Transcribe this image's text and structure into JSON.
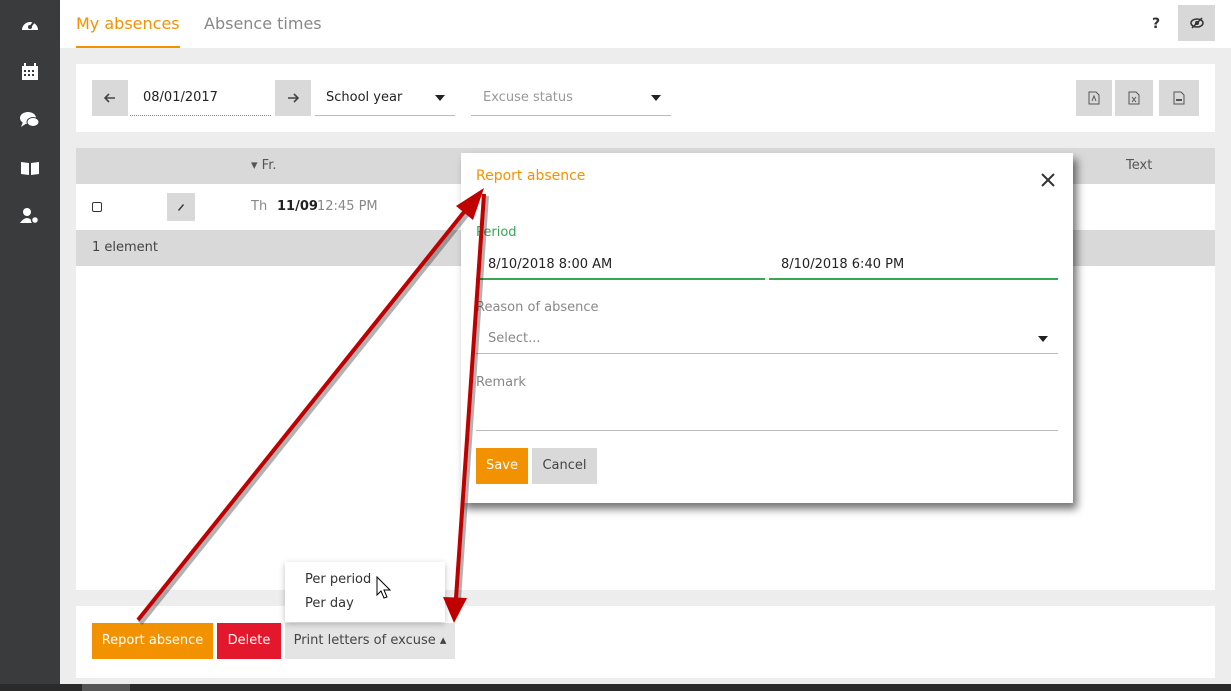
{
  "sidebar": {
    "icons": [
      "dashboard-icon",
      "calendar-icon",
      "chat-icon",
      "book-icon",
      "user-settings-icon"
    ]
  },
  "header": {
    "tabs": [
      {
        "label": "My absences",
        "active": true
      },
      {
        "label": "Absence times",
        "active": false
      }
    ],
    "help_label": "?"
  },
  "filters": {
    "date": "08/01/2017",
    "period_select": "School year",
    "excuse_status_placeholder": "Excuse status"
  },
  "table": {
    "headers": {
      "from": "▾ Fr.",
      "text": "Text"
    },
    "rows": [
      {
        "weekday": "Th",
        "date": "11/09",
        "time": "12:45 PM"
      }
    ],
    "footer": "1 element"
  },
  "actions": {
    "report_label": "Report absence",
    "delete_label": "Delete",
    "print_label": "Print letters of excuse ▴"
  },
  "print_menu": {
    "items": [
      "Per period",
      "Per day"
    ]
  },
  "dialog": {
    "title": "Report absence",
    "period_label": "Period",
    "period_start": "8/10/2018 8:00 AM",
    "period_end": "8/10/2018 6:40 PM",
    "reason_label": "Reason of absence",
    "reason_placeholder": "Select...",
    "remark_label": "Remark",
    "save_label": "Save",
    "cancel_label": "Cancel"
  },
  "colors": {
    "accent": "#f39200",
    "danger": "#e3182d",
    "success": "#3aa655",
    "annotation_arrow": "#c00000"
  }
}
